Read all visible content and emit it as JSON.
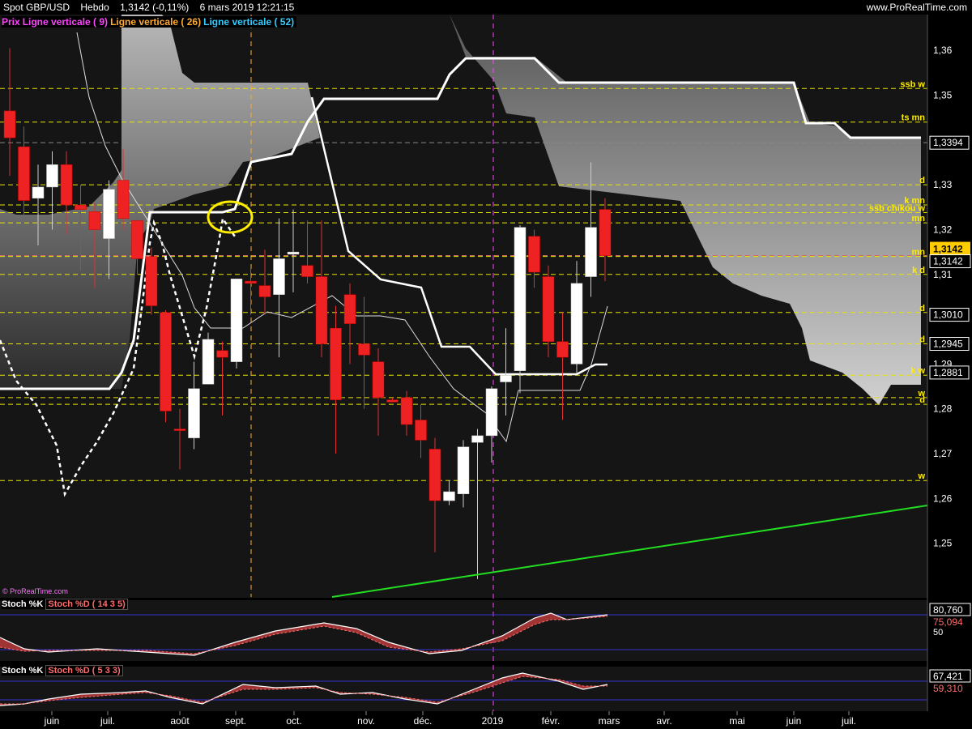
{
  "header": {
    "symbol": "Spot GBP/USD",
    "period": "Hebdo",
    "quote": "1,3142 (-0,11%)",
    "datetime": "6 mars 2019 12:21:15",
    "site": "www.ProRealTime.com",
    "watermark": "© ProRealTime.com"
  },
  "legend": [
    {
      "label": "Prix",
      "color": "#ff44ff"
    },
    {
      "label": "Ligne verticale ( 9)",
      "color": "#ff44ff"
    },
    {
      "label": "Ligne verticale ( 26)",
      "color": "#ffaa33"
    },
    {
      "label": "Ligne verticale ( 52)",
      "color": "#33ccff"
    }
  ],
  "months": [
    "juin",
    "juil.",
    "août",
    "sept.",
    "oct.",
    "nov.",
    "déc.",
    "2019",
    "févr.",
    "mars",
    "avr.",
    "mai",
    "juin",
    "juil."
  ],
  "chart_data": {
    "type": "candlestick",
    "title": "Spot GBP/USD",
    "timeframe": "Hebdo",
    "ylim": [
      1.238,
      1.368
    ],
    "y_ticks": [
      "1,25",
      "1,26",
      "1,27",
      "1,28",
      "1,29",
      "1,31",
      "1,32",
      "1,33",
      "1,35",
      "1,36"
    ],
    "candles": [
      {
        "o": 1.3465,
        "h": 1.3605,
        "l": 1.332,
        "c": 1.3405
      },
      {
        "o": 1.3385,
        "h": 1.343,
        "l": 1.323,
        "c": 1.3265
      },
      {
        "o": 1.327,
        "h": 1.3345,
        "l": 1.3165,
        "c": 1.3295
      },
      {
        "o": 1.3295,
        "h": 1.3375,
        "l": 1.32,
        "c": 1.3345
      },
      {
        "o": 1.3345,
        "h": 1.3375,
        "l": 1.319,
        "c": 1.3255
      },
      {
        "o": 1.3255,
        "h": 1.33,
        "l": 1.311,
        "c": 1.3245
      },
      {
        "o": 1.324,
        "h": 1.326,
        "l": 1.307,
        "c": 1.32
      },
      {
        "o": 1.318,
        "h": 1.331,
        "l": 1.309,
        "c": 1.329
      },
      {
        "o": 1.331,
        "h": 1.338,
        "l": 1.32,
        "c": 1.3225
      },
      {
        "o": 1.322,
        "h": 1.323,
        "l": 1.31,
        "c": 1.3135
      },
      {
        "o": 1.314,
        "h": 1.316,
        "l": 1.301,
        "c": 1.303
      },
      {
        "o": 1.3015,
        "h": 1.302,
        "l": 1.277,
        "c": 1.2795
      },
      {
        "o": 1.2755,
        "h": 1.28,
        "l": 1.2665,
        "c": 1.2752
      },
      {
        "o": 1.2735,
        "h": 1.2905,
        "l": 1.271,
        "c": 1.2845
      },
      {
        "o": 1.2855,
        "h": 1.297,
        "l": 1.2855,
        "c": 1.2955
      },
      {
        "o": 1.293,
        "h": 1.295,
        "l": 1.2785,
        "c": 1.2915
      },
      {
        "o": 1.2905,
        "h": 1.309,
        "l": 1.289,
        "c": 1.309
      },
      {
        "o": 1.3085,
        "h": 1.3115,
        "l": 1.301,
        "c": 1.308
      },
      {
        "o": 1.3075,
        "h": 1.3155,
        "l": 1.301,
        "c": 1.305
      },
      {
        "o": 1.3055,
        "h": 1.3225,
        "l": 1.2915,
        "c": 1.3135
      },
      {
        "o": 1.3145,
        "h": 1.3245,
        "l": 1.306,
        "c": 1.315
      },
      {
        "o": 1.312,
        "h": 1.322,
        "l": 1.308,
        "c": 1.3095
      },
      {
        "o": 1.3095,
        "h": 1.322,
        "l": 1.2915,
        "c": 1.2945
      },
      {
        "o": 1.298,
        "h": 1.303,
        "l": 1.27,
        "c": 1.282
      },
      {
        "o": 1.3055,
        "h": 1.308,
        "l": 1.29,
        "c": 1.299
      },
      {
        "o": 1.2945,
        "h": 1.305,
        "l": 1.28,
        "c": 1.292
      },
      {
        "o": 1.2905,
        "h": 1.2935,
        "l": 1.274,
        "c": 1.2825
      },
      {
        "o": 1.282,
        "h": 1.2825,
        "l": 1.2815,
        "c": 1.2815
      },
      {
        "o": 1.2825,
        "h": 1.284,
        "l": 1.274,
        "c": 1.2765
      },
      {
        "o": 1.2775,
        "h": 1.281,
        "l": 1.269,
        "c": 1.273
      },
      {
        "o": 1.271,
        "h": 1.2735,
        "l": 1.248,
        "c": 1.2595
      },
      {
        "o": 1.2595,
        "h": 1.264,
        "l": 1.2585,
        "c": 1.2615
      },
      {
        "o": 1.261,
        "h": 1.273,
        "l": 1.258,
        "c": 1.2715
      },
      {
        "o": 1.2725,
        "h": 1.2755,
        "l": 1.242,
        "c": 1.274
      },
      {
        "o": 1.274,
        "h": 1.285,
        "l": 1.268,
        "c": 1.2845
      },
      {
        "o": 1.286,
        "h": 1.298,
        "l": 1.2785,
        "c": 1.2875
      },
      {
        "o": 1.2885,
        "h": 1.321,
        "l": 1.2835,
        "c": 1.3205
      },
      {
        "o": 1.3185,
        "h": 1.32,
        "l": 1.307,
        "c": 1.3105
      },
      {
        "o": 1.3095,
        "h": 1.312,
        "l": 1.2915,
        "c": 1.295
      },
      {
        "o": 1.295,
        "h": 1.3015,
        "l": 1.2775,
        "c": 1.2915
      },
      {
        "o": 1.29,
        "h": 1.313,
        "l": 1.288,
        "c": 1.308
      },
      {
        "o": 1.3095,
        "h": 1.335,
        "l": 1.305,
        "c": 1.3205
      },
      {
        "o": 1.3245,
        "h": 1.327,
        "l": 1.3085,
        "c": 1.3142
      }
    ],
    "price_marker": {
      "value": "1,3142",
      "bg": "#ffcc00"
    },
    "right_values": [
      "1,3394",
      "1,3010",
      "1,2945",
      "1,2881"
    ],
    "level_tags": [
      {
        "y": 1.3515,
        "label": "ssb w"
      },
      {
        "y": 1.344,
        "label": "ts mn"
      },
      {
        "y": 1.33,
        "label": "d"
      },
      {
        "y": 1.3255,
        "label": "k mn"
      },
      {
        "y": 1.3238,
        "label": "ssb chikou w"
      },
      {
        "y": 1.3215,
        "label": "mn"
      },
      {
        "y": 1.314,
        "label": "mn"
      },
      {
        "y": 1.31,
        "label": "k d"
      },
      {
        "y": 1.3015,
        "label": "d"
      },
      {
        "y": 1.2945,
        "label": "d"
      },
      {
        "y": 1.2875,
        "label": "k w"
      },
      {
        "y": 1.2825,
        "label": "w"
      },
      {
        "y": 1.281,
        "label": "d"
      },
      {
        "y": 1.264,
        "label": "w"
      }
    ],
    "stoch1": {
      "label_k": "Stoch %K",
      "label_d": "Stoch %D ( 14 3 5)",
      "value_k": "80,760",
      "value_d": "75,094",
      "tick": "50"
    },
    "stoch2": {
      "label_k": "Stoch %K",
      "label_d": "Stoch %D ( 5 3 3)",
      "value_k": "67,421",
      "value_d": "59,310"
    }
  }
}
